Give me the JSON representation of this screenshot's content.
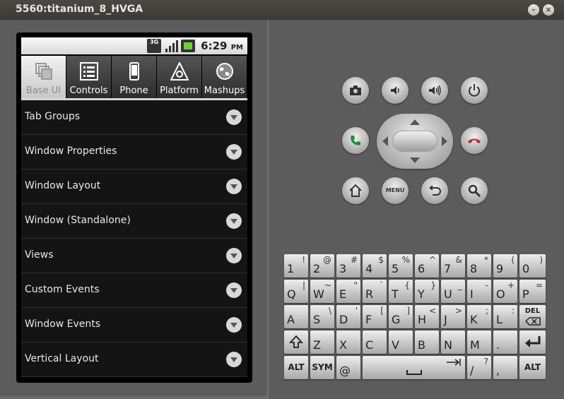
{
  "window": {
    "title": "5560:titanium_8_HVGA",
    "minimize_glyph": "–",
    "close_glyph": "×"
  },
  "statusbar": {
    "network": "3G",
    "time": "6:29",
    "ampm": "PM"
  },
  "tabs": [
    {
      "label": "Base UI",
      "icon": "windows-stack-icon",
      "active": true
    },
    {
      "label": "Controls",
      "icon": "list-icon",
      "active": false
    },
    {
      "label": "Phone",
      "icon": "phone-icon",
      "active": false
    },
    {
      "label": "Platform",
      "icon": "platform-icon",
      "active": false
    },
    {
      "label": "Mashups",
      "icon": "globe-icon",
      "active": false
    }
  ],
  "list": [
    "Tab Groups",
    "Window Properties",
    "Window Layout",
    "Window (Standalone)",
    "Views",
    "Custom Events",
    "Window Events",
    "Vertical Layout"
  ],
  "hardware": {
    "menu_label": "MENU"
  },
  "keyboard": {
    "rows": [
      [
        [
          "1",
          "!"
        ],
        [
          "2",
          "@"
        ],
        [
          "3",
          "#"
        ],
        [
          "4",
          "$"
        ],
        [
          "5",
          "%"
        ],
        [
          "6",
          "^"
        ],
        [
          "7",
          "&"
        ],
        [
          "8",
          "*"
        ],
        [
          "9",
          "("
        ],
        [
          "0",
          ")"
        ]
      ],
      [
        [
          "Q",
          "|"
        ],
        [
          "W",
          "~"
        ],
        [
          "E",
          "\""
        ],
        [
          "R",
          "`"
        ],
        [
          "T",
          "{"
        ],
        [
          "Y",
          "}"
        ],
        [
          "U",
          "_"
        ],
        [
          "I",
          "-"
        ],
        [
          "O",
          "+"
        ],
        [
          "P",
          "="
        ]
      ],
      [
        [
          "A",
          ""
        ],
        [
          "S",
          "\\"
        ],
        [
          "D",
          "'"
        ],
        [
          "F",
          "["
        ],
        [
          "G",
          "]"
        ],
        [
          "H",
          "<"
        ],
        [
          "J",
          ">"
        ],
        [
          "K",
          ";"
        ],
        [
          "L",
          ":"
        ]
      ],
      [
        [
          "Z",
          ""
        ],
        [
          "X",
          ""
        ],
        [
          "C",
          ""
        ],
        [
          "V",
          ""
        ],
        [
          "B",
          ""
        ],
        [
          "N",
          ""
        ],
        [
          "M",
          ""
        ],
        [
          ".",
          ""
        ]
      ]
    ],
    "del_label": "DEL",
    "alt_label": "ALT",
    "sym_label": "SYM",
    "at_label": "@",
    "slash_main": "/",
    "slash_alt": "?",
    "comma_label": ","
  }
}
